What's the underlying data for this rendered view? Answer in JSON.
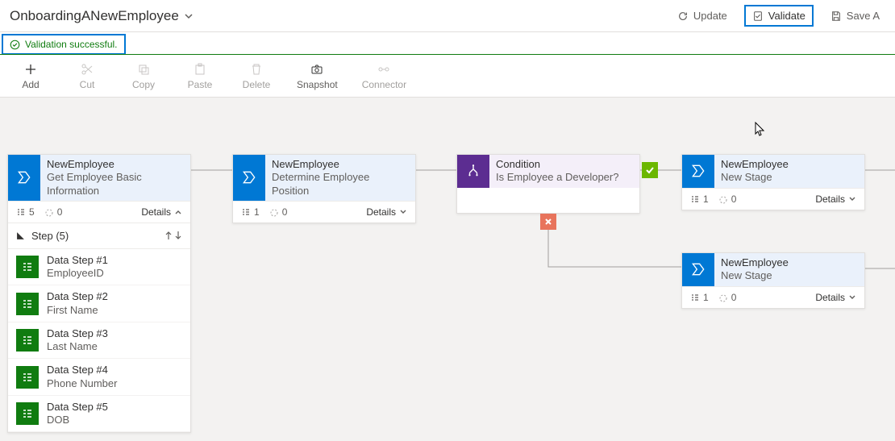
{
  "header": {
    "title": "OnboardingANewEmployee",
    "actions": {
      "update": "Update",
      "validate": "Validate",
      "save": "Save A"
    }
  },
  "validation_message": "Validation successful.",
  "toolbar": {
    "add": "Add",
    "cut": "Cut",
    "copy": "Copy",
    "paste": "Paste",
    "delete": "Delete",
    "snapshot": "Snapshot",
    "connector": "Connector"
  },
  "stages": [
    {
      "entity": "NewEmployee",
      "name": "Get Employee Basic Information",
      "step_count": "5",
      "duration": "0",
      "details_label": "Details",
      "expanded": true,
      "steps_header": "Step (5)",
      "steps": [
        {
          "name": "Data Step #1",
          "field": "EmployeeID"
        },
        {
          "name": "Data Step #2",
          "field": "First Name"
        },
        {
          "name": "Data Step #3",
          "field": "Last Name"
        },
        {
          "name": "Data Step #4",
          "field": "Phone Number"
        },
        {
          "name": "Data Step #5",
          "field": "DOB"
        }
      ]
    },
    {
      "entity": "NewEmployee",
      "name": "Determine Employee Position",
      "step_count": "1",
      "duration": "0",
      "details_label": "Details",
      "expanded": false
    },
    {
      "entity": "NewEmployee",
      "name": "New Stage",
      "step_count": "1",
      "duration": "0",
      "details_label": "Details",
      "expanded": false
    },
    {
      "entity": "NewEmployee",
      "name": "New Stage",
      "step_count": "1",
      "duration": "0",
      "details_label": "Details",
      "expanded": false
    }
  ],
  "condition": {
    "label": "Condition",
    "question": "Is Employee a Developer?"
  }
}
